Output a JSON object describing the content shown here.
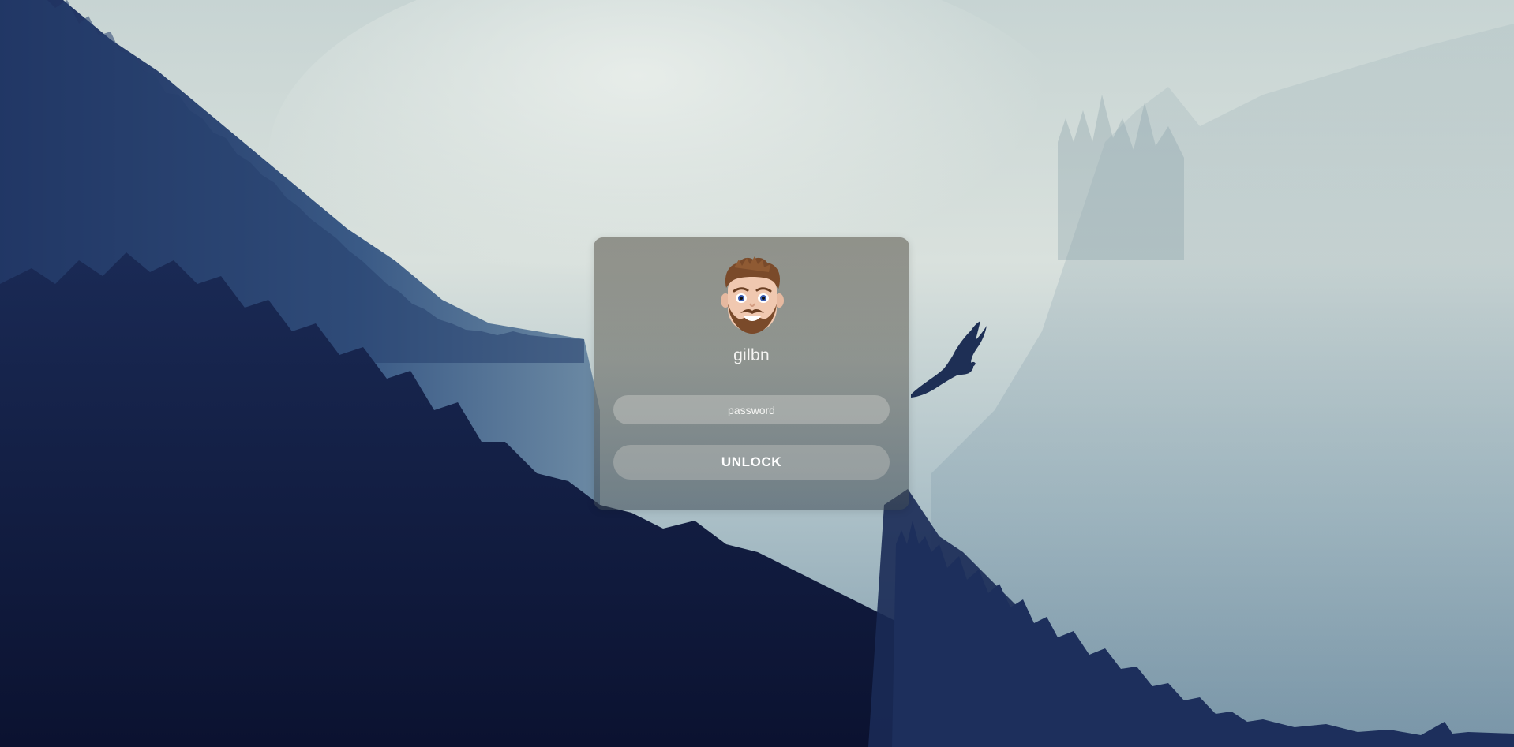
{
  "user": {
    "name": "gilbn",
    "avatar_icon": "memoji-avatar-icon"
  },
  "login": {
    "password_placeholder": "password",
    "password_value": "",
    "unlock_label": "UNLOCK"
  },
  "colors": {
    "card_tint": "#7f7f78",
    "forest_dark": "#10193a",
    "fog": "#d6dfdc"
  }
}
